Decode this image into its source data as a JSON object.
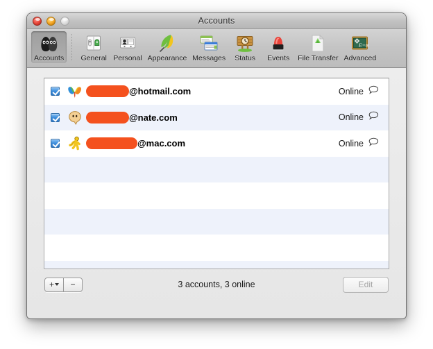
{
  "window": {
    "title": "Accounts",
    "controls": [
      {
        "name": "close-button",
        "label": "Close"
      },
      {
        "name": "minimize-button",
        "label": "Minimize"
      },
      {
        "name": "zoom-button",
        "label": "Zoom"
      }
    ]
  },
  "toolbar": {
    "items": [
      {
        "label": "Accounts",
        "icon": "buddies-icon",
        "selected": true
      },
      {
        "label": "General",
        "icon": "general-icon",
        "selected": false
      },
      {
        "label": "Personal",
        "icon": "personal-icon",
        "selected": false
      },
      {
        "label": "Appearance",
        "icon": "feather-icon",
        "selected": false
      },
      {
        "label": "Messages",
        "icon": "messages-icon",
        "selected": false
      },
      {
        "label": "Status",
        "icon": "clock-sign-icon",
        "selected": false
      },
      {
        "label": "Events",
        "icon": "siren-icon",
        "selected": false
      },
      {
        "label": "File Transfer",
        "icon": "file-transfer-icon",
        "selected": false
      },
      {
        "label": "Advanced",
        "icon": "chalkboard-icon",
        "selected": false
      }
    ]
  },
  "accounts": {
    "rows": [
      {
        "enabled": true,
        "service_icon": "msn-butterfly-icon",
        "name_redacted": true,
        "redaction_width": 62,
        "domain": "@hotmail.com",
        "status": "Online",
        "chat_icon": "speech-bubble-icon"
      },
      {
        "enabled": true,
        "service_icon": "jabber-smiley-icon",
        "name_redacted": true,
        "redaction_width": 62,
        "domain": "@nate.com",
        "status": "Online",
        "chat_icon": "speech-bubble-icon"
      },
      {
        "enabled": true,
        "service_icon": "aim-runner-icon",
        "name_redacted": true,
        "redaction_width": 74,
        "domain": "@mac.com",
        "status": "Online",
        "chat_icon": "speech-bubble-icon"
      }
    ],
    "empty_row_count": 4
  },
  "bottom_bar": {
    "add_label": "+",
    "remove_label": "−",
    "summary": "3 accounts, 3 online",
    "edit_label": "Edit"
  },
  "colors": {
    "redaction": "#f4511e",
    "row_stripe": "#eef2fb",
    "checkbox": "#3f8fdc"
  }
}
